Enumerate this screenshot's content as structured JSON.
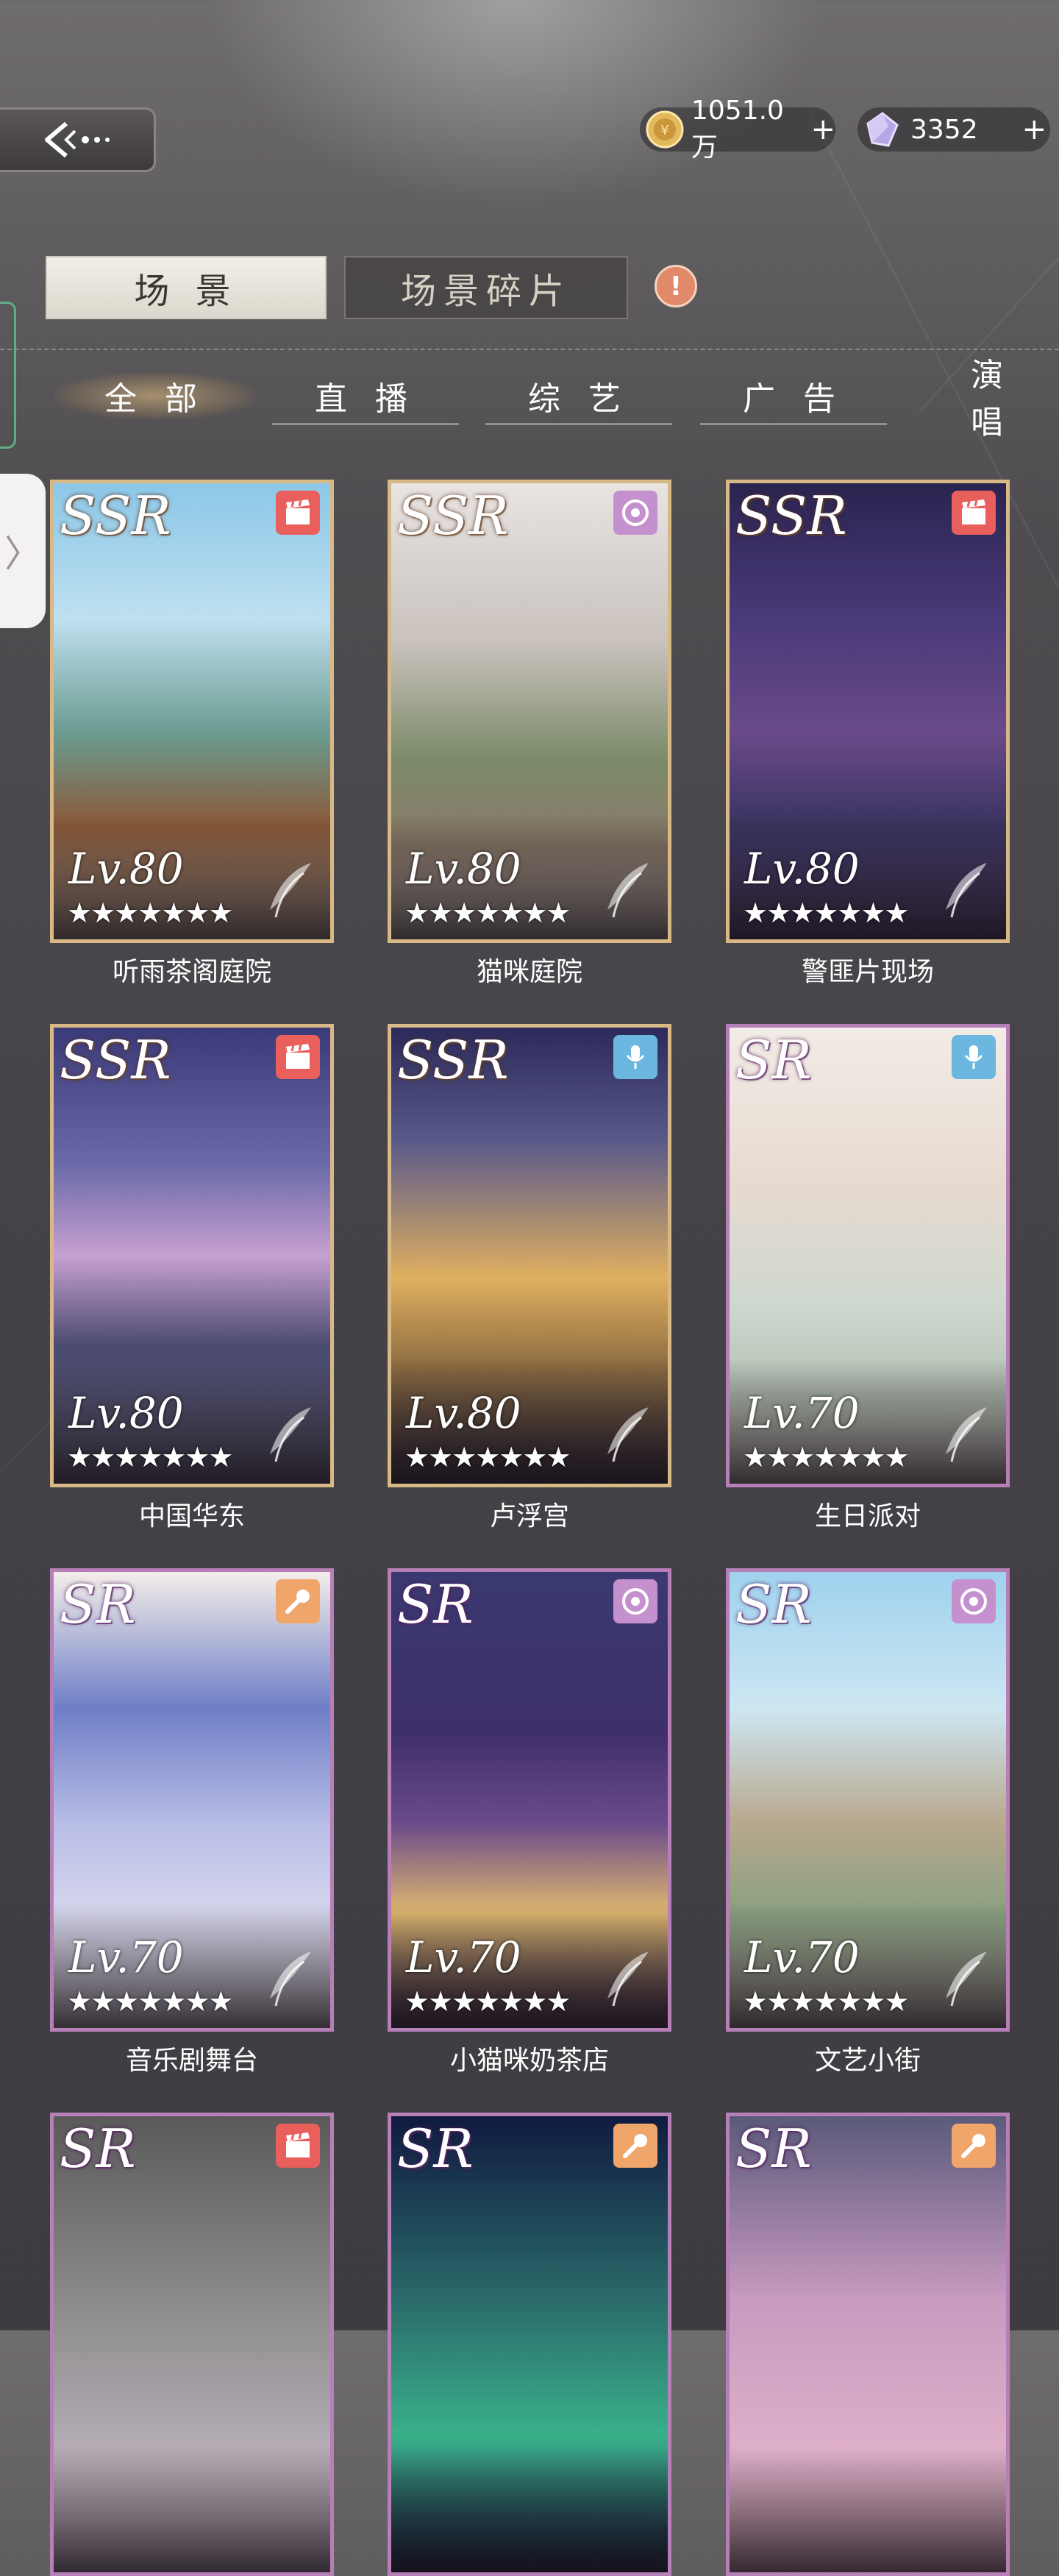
{
  "header": {
    "coins": "1051.0万",
    "gems": "3352",
    "plus": "+"
  },
  "top_tabs": [
    {
      "label": "场 景",
      "active": true
    },
    {
      "label": "场景碎片",
      "active": false
    }
  ],
  "alert_symbol": "!",
  "categories": [
    {
      "label": "全 部",
      "active": true
    },
    {
      "label": "直 播",
      "active": false
    },
    {
      "label": "综 艺",
      "active": false
    },
    {
      "label": "广 告",
      "active": false
    },
    {
      "label": "演 唱",
      "active": false
    }
  ],
  "side_drawer_symbol": "〉",
  "stars": "★★★★★★★",
  "cards": [
    {
      "name": "听雨茶阁庭院",
      "rarity": "SSR",
      "level": "Lv.80",
      "tag": "film-icon"
    },
    {
      "name": "猫咪庭院",
      "rarity": "SSR",
      "level": "Lv.80",
      "tag": "disc-icon"
    },
    {
      "name": "警匪片现场",
      "rarity": "SSR",
      "level": "Lv.80",
      "tag": "film-icon"
    },
    {
      "name": "中国华东",
      "rarity": "SSR",
      "level": "Lv.80",
      "tag": "film-icon"
    },
    {
      "name": "卢浮宫",
      "rarity": "SSR",
      "level": "Lv.80",
      "tag": "mic-icon"
    },
    {
      "name": "生日派对",
      "rarity": "SR",
      "level": "Lv.70",
      "tag": "mic-icon"
    },
    {
      "name": "音乐剧舞台",
      "rarity": "SR",
      "level": "Lv.70",
      "tag": "handmic-icon"
    },
    {
      "name": "小猫咪奶茶店",
      "rarity": "SR",
      "level": "Lv.70",
      "tag": "disc-icon"
    },
    {
      "name": "文艺小街",
      "rarity": "SR",
      "level": "Lv.70",
      "tag": "disc-icon"
    },
    {
      "name": "",
      "rarity": "SR",
      "level": "",
      "tag": "film-icon"
    },
    {
      "name": "",
      "rarity": "SR",
      "level": "",
      "tag": "handmic-icon"
    },
    {
      "name": "",
      "rarity": "SR",
      "level": "",
      "tag": "handmic-icon"
    }
  ],
  "colors": {
    "ssr_border": "#d8b985",
    "sr_border": "#b77fb8",
    "film_tag": "#e85f5c",
    "disc_tag": "#c590ce",
    "mic_tag": "#6bb7e0",
    "handmic_tag": "#f0a56a"
  }
}
